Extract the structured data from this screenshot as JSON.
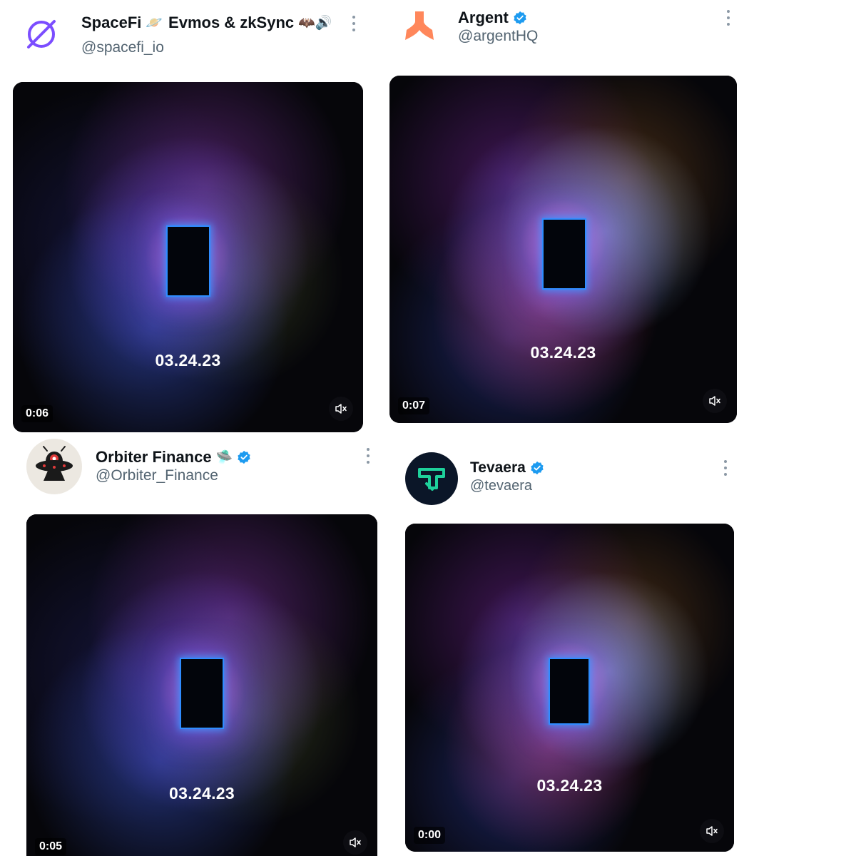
{
  "posts": [
    {
      "name": "SpaceFi",
      "name_extra": "Evmos & zkSync",
      "emoji_after_name": "🪐",
      "emoji_tail": "🦇🔊",
      "handle": "@spacefi_io",
      "verified": false,
      "avatar_icon": "spacefi-logo-icon",
      "video": {
        "date_text": "03.24.23",
        "time": "0:06",
        "muted": true
      }
    },
    {
      "name": "Argent",
      "handle": "@argentHQ",
      "verified": true,
      "avatar_icon": "argent-logo-icon",
      "video": {
        "date_text": "03.24.23",
        "time": "0:07",
        "muted": true
      }
    },
    {
      "name": "Orbiter Finance",
      "emoji_after_name": "🛸",
      "handle": "@Orbiter_Finance",
      "verified": true,
      "avatar_icon": "orbiter-logo-icon",
      "video": {
        "date_text": "03.24.23",
        "time": "0:05",
        "muted": true
      }
    },
    {
      "name": "Tevaera",
      "handle": "@tevaera",
      "verified": true,
      "avatar_icon": "tevaera-logo-icon",
      "video": {
        "date_text": "03.24.23",
        "time": "0:00",
        "muted": true
      }
    }
  ],
  "colors": {
    "verified_badge": "#1d9bf0",
    "argent_orange": "#ff875b",
    "spacefi_purple": "#7b4dff",
    "tevaera_green": "#1ed19b"
  }
}
